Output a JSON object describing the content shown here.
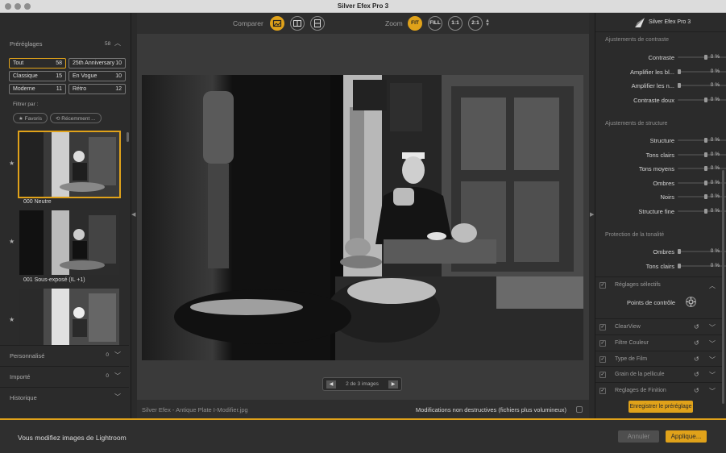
{
  "window": {
    "title": "Silver Efex Pro 3"
  },
  "left": {
    "presets_header": "Préréglages",
    "presets_count": "58",
    "categories": [
      {
        "label": "Tout",
        "count": "58"
      },
      {
        "label": "25th Anniversary",
        "count": "10"
      },
      {
        "label": "Classique",
        "count": "15"
      },
      {
        "label": "En Vogue",
        "count": "10"
      },
      {
        "label": "Moderne",
        "count": "11"
      },
      {
        "label": "Rétro",
        "count": "12"
      }
    ],
    "filter_label": "Filtrer par :",
    "filter_chips": [
      "★ Favoris",
      "⟲ Récemment ..."
    ],
    "thumbs": [
      {
        "caption": "000 Neutre"
      },
      {
        "caption": "001 Sous-exposé (IL +1)"
      },
      {
        "caption": ""
      }
    ],
    "sections": [
      {
        "label": "Personnalisé",
        "count": "0"
      },
      {
        "label": "Importé",
        "count": "0"
      },
      {
        "label": "Historique",
        "count": ""
      }
    ]
  },
  "toolbar": {
    "compare_label": "Comparer",
    "zoom_label": "Zoom",
    "zoom_options": [
      "FIT",
      "FILL",
      "1:1",
      "2:1"
    ]
  },
  "center": {
    "nav_text": "2 de 3 images",
    "filename": "Silver Efex - Antique Plate I-Modifier.jpg",
    "nondestructive_label": "Modifications non destructives (fichiers plus volumineux)"
  },
  "right": {
    "logo_text": "Silver Efex Pro 3",
    "contrast_header": "Ajustements de contraste",
    "contrast_rows": [
      {
        "label": "Contraste",
        "value": "0 %",
        "level": 0.5
      },
      {
        "label": "Amplifier les bl...",
        "value": "0 %",
        "level": 0
      },
      {
        "label": "Amplifier les n...",
        "value": "0 %",
        "level": 0
      },
      {
        "label": "Contraste doux",
        "value": "0 %",
        "level": 0.5
      }
    ],
    "structure_header": "Ajustements de structure",
    "structure_rows": [
      {
        "label": "Structure",
        "value": "0 %",
        "level": 0.5
      },
      {
        "label": "Tons clairs",
        "value": "0 %",
        "level": 0.5
      },
      {
        "label": "Tons moyens",
        "value": "0 %",
        "level": 0.5
      },
      {
        "label": "Ombres",
        "value": "0 %",
        "level": 0.5
      },
      {
        "label": "Noirs",
        "value": "0 %",
        "level": 0.5
      },
      {
        "label": "Structure fine",
        "value": "0 %",
        "level": 0.5
      }
    ],
    "tone_header": "Protection de la tonalité",
    "tone_rows": [
      {
        "label": "Ombres",
        "value": "0 %",
        "level": 0
      },
      {
        "label": "Tons clairs",
        "value": "0 %",
        "level": 0
      }
    ],
    "selective_label": "Réglages sélectifs",
    "control_points_label": "Points de contrôle",
    "filters": [
      "ClearView",
      "Filtre Couleur",
      "Type de Film",
      "Grain de la pellicule",
      "Reglages de Finition"
    ],
    "save_preset": "Enregistrer le préréglage"
  },
  "bottom": {
    "message": "Vous modifiez images de Lightroom",
    "cancel": "Annuler",
    "apply": "Applique..."
  },
  "colors": {
    "accent": "#e0a21a"
  }
}
